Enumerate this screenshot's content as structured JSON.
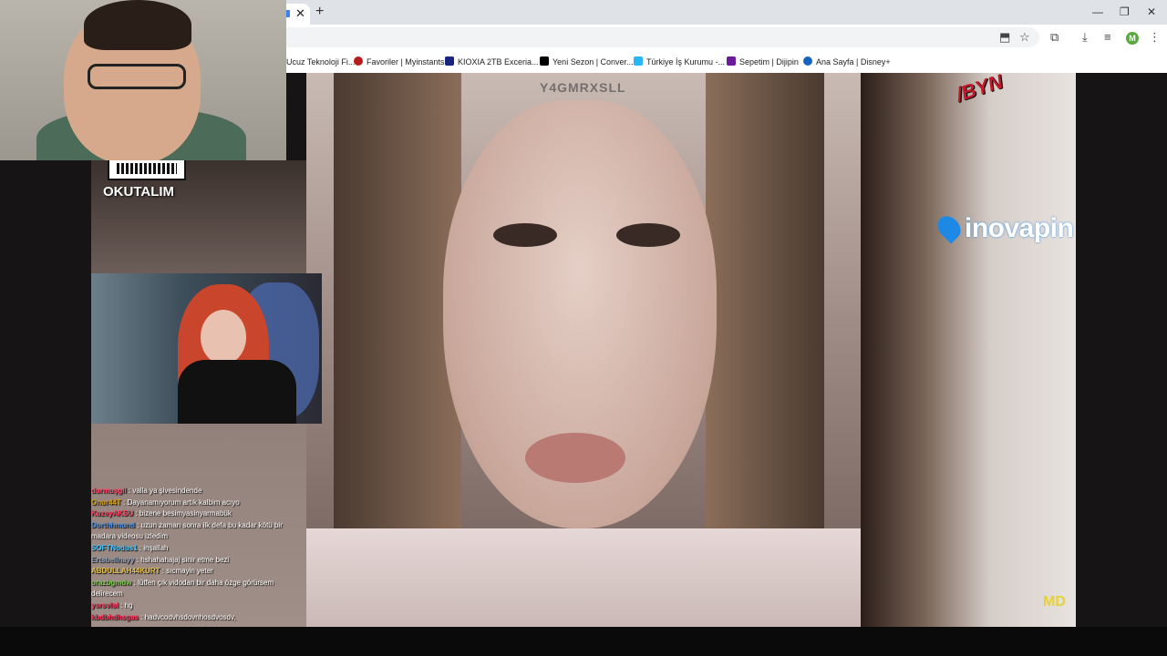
{
  "browser": {
    "tab_close": "✕",
    "new_tab": "+",
    "window": {
      "minimize": "—",
      "restore": "❐",
      "close": "✕"
    },
    "avatar_letter": "M",
    "bookmarks": [
      {
        "label": "Ucuz Teknoloji Fi...",
        "color": "#ff6d00"
      },
      {
        "label": "Favoriler | Myinstants",
        "color": "#b71c1c"
      },
      {
        "label": "KIOXIA 2TB Exceria...",
        "color": "#1a237e"
      },
      {
        "label": "Yeni Sezon | Conver...",
        "color": "#000000"
      },
      {
        "label": "Türkiye İş Kurumu -...",
        "color": "#29b6f6"
      },
      {
        "label": "Sepetim | Dijipin",
        "color": "#6a1b9a"
      },
      {
        "label": "Ana Sayfa | Disney+",
        "color": "#1565c0"
      }
    ]
  },
  "overlay": {
    "qr_label": "OKUTALIM",
    "watermark": "Y4GMRXSLL",
    "corner_tag": "/BYN",
    "sponsor": "inovapin",
    "corner_logo": "MD"
  },
  "chat": [
    {
      "user": "durmuşgil",
      "text": "valla ya şivesindende",
      "color": "#ff4d6d"
    },
    {
      "user": "Onur44T",
      "text": "Dayanamıyorum artık kalbim acıyo",
      "color": "#d4a017"
    },
    {
      "user": "KuzeyAKSU",
      "text": "bizene besimyasinyarmabük",
      "color": "#ff3b5c"
    },
    {
      "user": "Dorthhmund",
      "text": "uzun zaman sonra ilk defa bu kadar kötü bir madara videosu izledim",
      "color": "#4a90e2"
    },
    {
      "user": "SOFTNodus1",
      "text": "inşallah",
      "color": "#4fc3f7"
    },
    {
      "user": "Ertsbellnayy",
      "text": "hshahahajaj sinir etme bezi",
      "color": "#8fa3b8"
    },
    {
      "user": "ABDULLAH44KURT",
      "text": "sıcmayin yeter",
      "color": "#e6c24a"
    },
    {
      "user": "orazbgmdw",
      "text": "lütfen çık vidodan bir daha özge görürsem delirecem",
      "color": "#7bd148"
    },
    {
      "user": "ysrsvlsl",
      "text": "hg",
      "color": "#ff2d55"
    },
    {
      "user": "kbdbhdhsgas",
      "text": "hadvcodvhsdovnhosdvosdv,",
      "color": "#ff2d55"
    }
  ]
}
